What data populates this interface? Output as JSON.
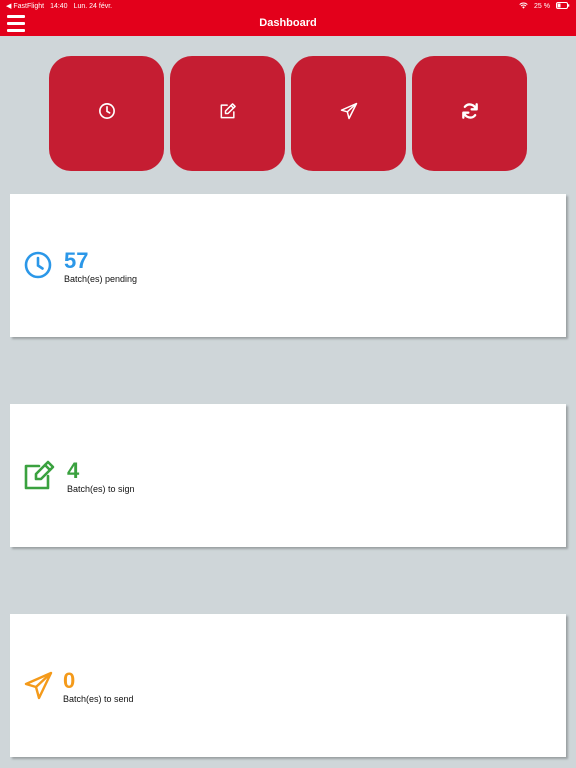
{
  "status_bar": {
    "carrier": "◀ FastFlight",
    "time": "14:40",
    "date": "Lun. 24 févr.",
    "battery": "25 %"
  },
  "nav": {
    "title": "Dashboard"
  },
  "quick_actions": [
    {
      "icon": "clock-icon"
    },
    {
      "icon": "edit-icon"
    },
    {
      "icon": "send-icon"
    },
    {
      "icon": "refresh-icon"
    }
  ],
  "cards": {
    "pending": {
      "count": "57",
      "label": "Batch(es) pending",
      "color": "#2b97e8",
      "icon": "clock-icon"
    },
    "sign": {
      "count": "4",
      "label": "Batch(es) to sign",
      "color": "#3aa13f",
      "icon": "edit-icon"
    },
    "send": {
      "count": "0",
      "label": "Batch(es) to send",
      "color": "#f49a1a",
      "icon": "send-icon"
    }
  },
  "colors": {
    "brand": "#e3001b",
    "button": "#c51d32",
    "background": "#cfd6d9"
  }
}
